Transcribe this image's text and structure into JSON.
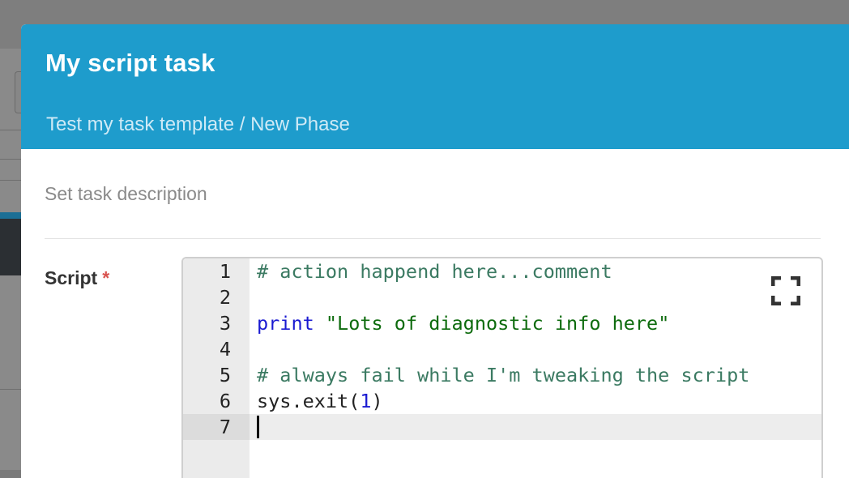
{
  "modal": {
    "title": "My script task",
    "subtitle": "Test my task template / New Phase",
    "description_placeholder": "Set task description"
  },
  "script_field": {
    "label": "Script",
    "required_mark": "*"
  },
  "editor": {
    "fullscreen_icon": "expand-icon",
    "active_line": 7,
    "lines": [
      {
        "number": "1",
        "tokens": [
          {
            "type": "comment",
            "text": "# action happend here...comment"
          }
        ]
      },
      {
        "number": "2",
        "tokens": []
      },
      {
        "number": "3",
        "tokens": [
          {
            "type": "kw",
            "text": "print"
          },
          {
            "type": "plain",
            "text": " "
          },
          {
            "type": "str",
            "text": "\"Lots of diagnostic info here\""
          }
        ]
      },
      {
        "number": "4",
        "tokens": []
      },
      {
        "number": "5",
        "tokens": [
          {
            "type": "comment",
            "text": "# always fail while I'm tweaking the script"
          }
        ]
      },
      {
        "number": "6",
        "tokens": [
          {
            "type": "plain",
            "text": "sys.exit("
          },
          {
            "type": "num",
            "text": "1"
          },
          {
            "type": "plain",
            "text": ")"
          }
        ]
      },
      {
        "number": "7",
        "tokens": []
      }
    ]
  },
  "colors": {
    "header": "#1e9ccc",
    "comment": "#3b7a62",
    "keyword": "#1a1ad1",
    "string": "#0d6b0d",
    "required": "#d9534f"
  }
}
